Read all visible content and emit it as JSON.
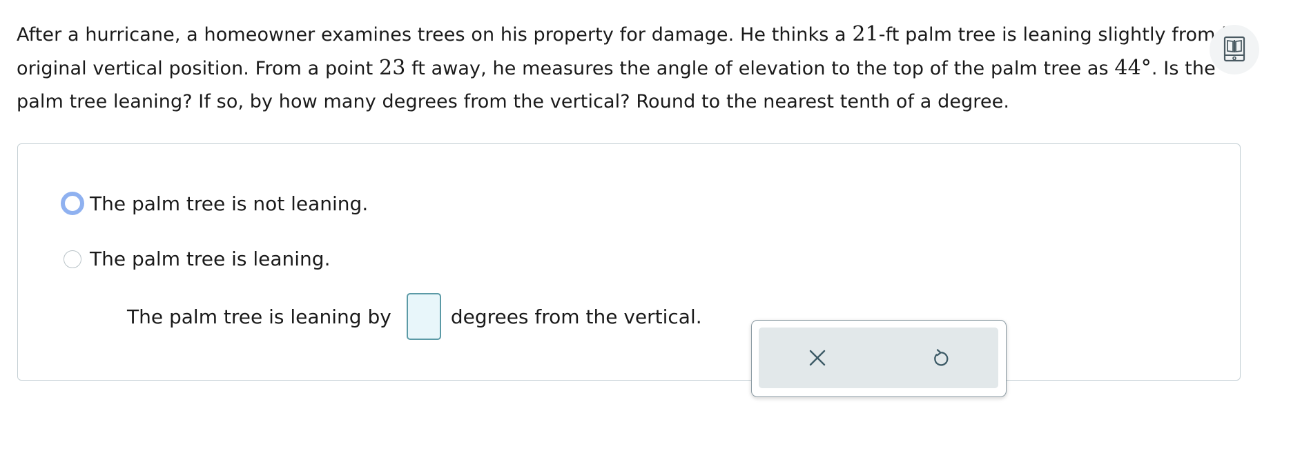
{
  "question": {
    "part1": "After a hurricane, a homeowner examines trees on his property for damage. He thinks a ",
    "height_value": "21",
    "part2": "-ft palm tree is leaning slightly from its original vertical position. From a point ",
    "distance_value": "23",
    "part3": " ft away, he measures the angle of elevation to the top of the palm tree as ",
    "angle_value": "44°",
    "part4": ". Is the palm tree leaning? If so, by how many degrees from the vertical? Round to the nearest tenth of a degree."
  },
  "options": [
    {
      "label": "The palm tree is not leaning.",
      "state": "focused"
    },
    {
      "label": "The palm tree is leaning.",
      "state": "unselected"
    }
  ],
  "fill_in": {
    "prefix": "The palm tree is leaning by",
    "value": "",
    "suffix": "degrees from the vertical."
  },
  "tools": {
    "clear_icon": "close-icon",
    "undo_icon": "undo-icon"
  },
  "colors": {
    "focus_ring": "#8fb1f0",
    "answer_box_border": "#5b9aa6",
    "answer_box_fill": "#e8f6fa",
    "tool_icon": "#3c5a66"
  }
}
